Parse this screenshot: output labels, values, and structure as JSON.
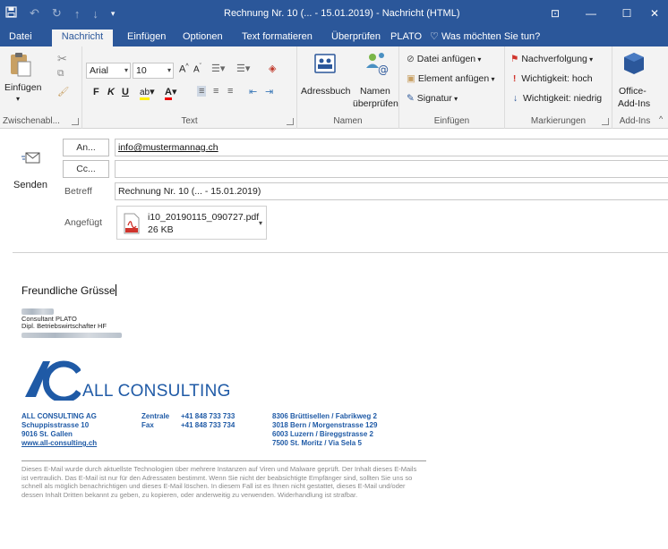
{
  "titlebar": {
    "title": "Rechnung Nr. 10 (... - 15.01.2019) - Nachricht (HTML)",
    "window_buttons": [
      "⊡",
      "—",
      "☐",
      "✕"
    ]
  },
  "tabs": [
    {
      "label": "Datei"
    },
    {
      "label": "Nachricht"
    },
    {
      "label": "Einfügen"
    },
    {
      "label": "Optionen"
    },
    {
      "label": "Text formatieren"
    },
    {
      "label": "Überprüfen"
    },
    {
      "label": "PLATO"
    },
    {
      "label": "Was möchten Sie tun?"
    }
  ],
  "ribbon": {
    "clipboard": {
      "paste": "Einfügen",
      "group": "Zwischenabl..."
    },
    "text": {
      "font": "Arial",
      "size": "10",
      "bold": "F",
      "italic": "K",
      "underline": "U",
      "group": "Text"
    },
    "names": {
      "addressbook": "Adressbuch",
      "check_names_1": "Namen",
      "check_names_2": "überprüfen",
      "group": "Namen"
    },
    "include": {
      "attach_file": "Datei anfügen",
      "attach_item": "Element anfügen",
      "signature": "Signatur",
      "group": "Einfügen"
    },
    "tags": {
      "followup": "Nachverfolgung",
      "high": "Wichtigkeit: hoch",
      "low": "Wichtigkeit: niedrig",
      "group": "Markierungen"
    },
    "addins": {
      "office_1": "Office-",
      "office_2": "Add-Ins",
      "group": "Add-Ins"
    }
  },
  "compose": {
    "send": "Senden",
    "to_button": "An...",
    "to_value": "info@mustermannag.ch",
    "cc_button": "Cc...",
    "cc_value": "",
    "subject_label": "Betreff",
    "subject_value": "Rechnung Nr. 10 (... - 15.01.2019)",
    "attached_label": "Angefügt",
    "attachment_name": "i10_20190115_090727.pdf",
    "attachment_size": "26 KB"
  },
  "body": {
    "greeting": "Freundliche Grüsse",
    "title_line": "Consultant PLATO",
    "degree_line": "Dipl. Betriebswirtschafter HF",
    "logo_text": "ALL CONSULTING",
    "company": {
      "name": "ALL CONSULTING AG",
      "street": "Schuppisstrasse 10",
      "city": "9016 St. Gallen",
      "web": "www.all-consulting.ch"
    },
    "contact": {
      "central_label": "Zentrale",
      "central_number": "+41 848 733 733",
      "fax_label": "Fax",
      "fax_number": "+41 848 733 734"
    },
    "locations": [
      "8306 Brüttisellen / Fabrikweg 2",
      "3018 Bern / Morgenstrasse 129",
      "6003 Luzern / Bireggstrasse 2",
      "7500 St. Moritz / Via Sela 5"
    ],
    "disclaimer": "Dieses E-Mail wurde durch aktuellste Technologien über mehrere Instanzen auf Viren und Malware geprüft. Der Inhalt dieses E-Mails ist vertraulich. Das E-Mail ist nur für den Adressaten bestimmt. Wenn Sie nicht der beabsichtigte Empfänger sind, sollten Sie uns so schnell als möglich benachrichtigen und dieses E-Mail löschen. In diesem Fall ist es Ihnen nicht gestattet, dieses E-Mail und/oder dessen Inhalt Dritten bekannt zu geben, zu kopieren, oder anderweitig zu verwenden. Widerhandlung ist strafbar."
  },
  "colors": {
    "accent": "#2b579a",
    "brand_blue": "#1f5aa6"
  }
}
